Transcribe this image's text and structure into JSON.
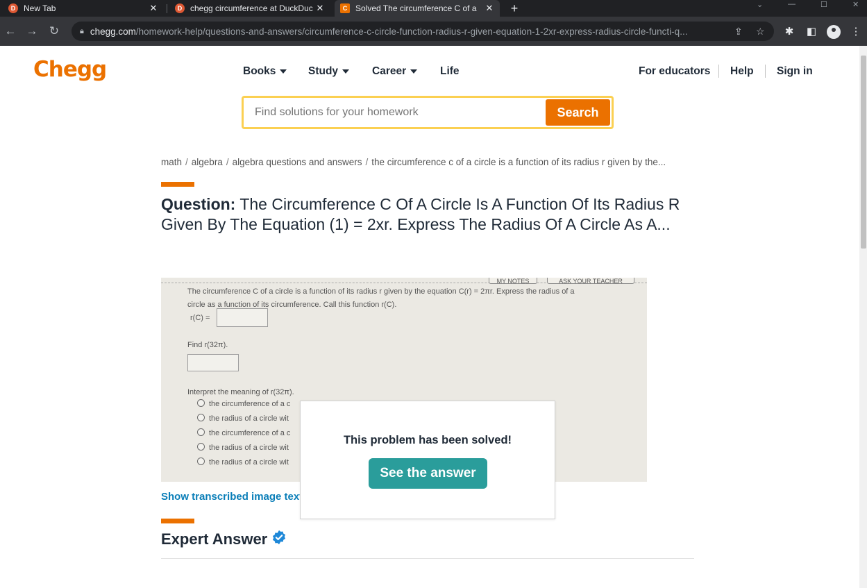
{
  "browser": {
    "tabs": [
      {
        "title": "New Tab",
        "favicon": "duckduckgo-icon",
        "active": false
      },
      {
        "title": "chegg circumference at DuckDuc",
        "favicon": "duckduckgo-icon",
        "active": false
      },
      {
        "title": "Solved The circumference C of a",
        "favicon": "chegg-icon",
        "active": true
      }
    ],
    "new_tab": "+",
    "url_host": "chegg.com",
    "url_path": "/homework-help/questions-and-answers/circumference-c-circle-function-radius-r-given-equation-1-2xr-express-radius-circle-functi-q..."
  },
  "site": {
    "logo": "Chegg",
    "nav": [
      "Books",
      "Study",
      "Career",
      "Life"
    ],
    "nav_right": [
      "For educators",
      "Help",
      "Sign in"
    ],
    "search": {
      "placeholder": "Find solutions for your homework",
      "button": "Search"
    },
    "breadcrumb": [
      "math",
      "algebra",
      "algebra questions and answers",
      "the circumference c of a circle is a function of its radius r given by the..."
    ]
  },
  "question": {
    "label": "Question:",
    "line1": "The Circumference C Of A Circle Is A Function Of Its Radius R",
    "line2": "Given By The Equation (1) = 2xr. Express The Radius Of A Circle As A...",
    "image": {
      "pill1": "MY NOTES",
      "pill2": "ASK YOUR TEACHER",
      "text1": "The circumference C of a circle is a function of its radius r given by the equation  C(r) = 2πr.  Express the radius of a",
      "text2": "circle as a function of its circumference. Call this function  r(C).",
      "rc_label": "r(C) =",
      "find_label": "Find  r(32π).",
      "interpret_label": "Interpret the meaning of  r(32π).",
      "options": [
        "the circumference of a c",
        "the radius of a circle wit",
        "the circumference of a c",
        "the radius of a circle wit",
        "the radius of a circle wit"
      ]
    },
    "show_transcribed": "Show transcribed image text"
  },
  "popup": {
    "message": "This problem has been solved!",
    "button": "See the answer"
  },
  "expert": {
    "heading": "Expert Answer"
  },
  "colors": {
    "brand": "#eb7100",
    "teal": "#2a9d9b",
    "link": "#0a7eb8",
    "search_border": "#fbd052"
  }
}
